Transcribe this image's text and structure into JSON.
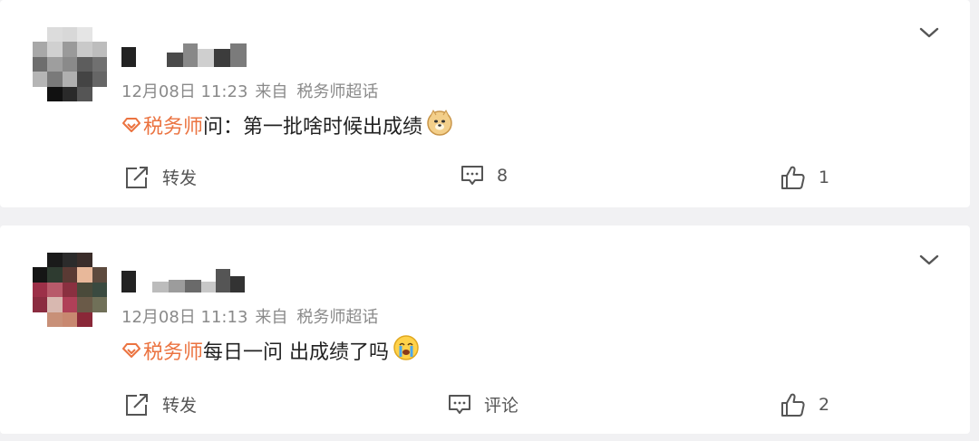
{
  "posts": [
    {
      "time": "12月08日 11:23",
      "source_prefix": "来自",
      "source": "税务师超话",
      "topic": "税务师",
      "text": "问：第一批啥时候出成绩",
      "emoji_icon": "doge-emoji-icon",
      "actions": {
        "repost": "转发",
        "comment": "8",
        "like": "1"
      }
    },
    {
      "time": "12月08日 11:13",
      "source_prefix": "来自",
      "source": "税务师超话",
      "topic": "税务师",
      "text": "每日一问 出成绩了吗",
      "emoji_icon": "crying-face-emoji-icon",
      "actions": {
        "repost": "转发",
        "comment": "评论",
        "like": "2"
      }
    }
  ],
  "colors": {
    "topic": "#eb7340",
    "meta": "#8a8a8a",
    "background": "#f1f1f3"
  }
}
